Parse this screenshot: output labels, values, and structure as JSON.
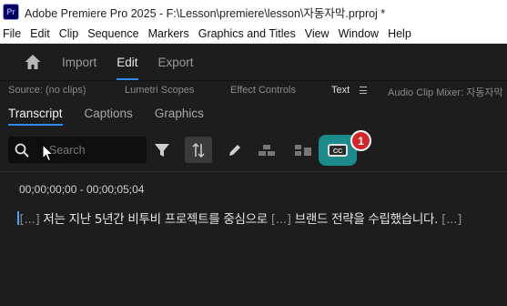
{
  "window": {
    "logo_text": "Pr",
    "title": "Adobe Premiere Pro 2025 - F:\\Lesson\\premiere\\lesson\\자동자막.prproj *"
  },
  "menu": [
    "File",
    "Edit",
    "Clip",
    "Sequence",
    "Markers",
    "Graphics and Titles",
    "View",
    "Window",
    "Help"
  ],
  "workspace": {
    "tabs": [
      "Import",
      "Edit",
      "Export"
    ],
    "active": "Edit"
  },
  "panel_tabs": {
    "source": "Source: (no clips)",
    "lumetri": "Lumetri Scopes",
    "effect_controls": "Effect Controls",
    "text": "Text",
    "audio_mixer": "Audio Clip Mixer: 자동자막"
  },
  "sub_tabs": {
    "transcript": "Transcript",
    "captions": "Captions",
    "graphics": "Graphics"
  },
  "search": {
    "placeholder": "Search"
  },
  "badge": {
    "number": "1"
  },
  "cc_label": "CC",
  "timecode": "00;00;00;00 - 00;00;05;04",
  "transcript": {
    "gap1": "[...]",
    "text1": " 저는 지난 5년간 비투비 프로젝트를 중심으로 ",
    "gap2": "[...]",
    "text2": " 브랜드 전략을 수립했습니다. ",
    "gap3": "[...]"
  },
  "colors": {
    "accent_blue": "#2d8ceb",
    "cc_highlight": "#1b8a8a",
    "badge_red": "#d7262b"
  }
}
